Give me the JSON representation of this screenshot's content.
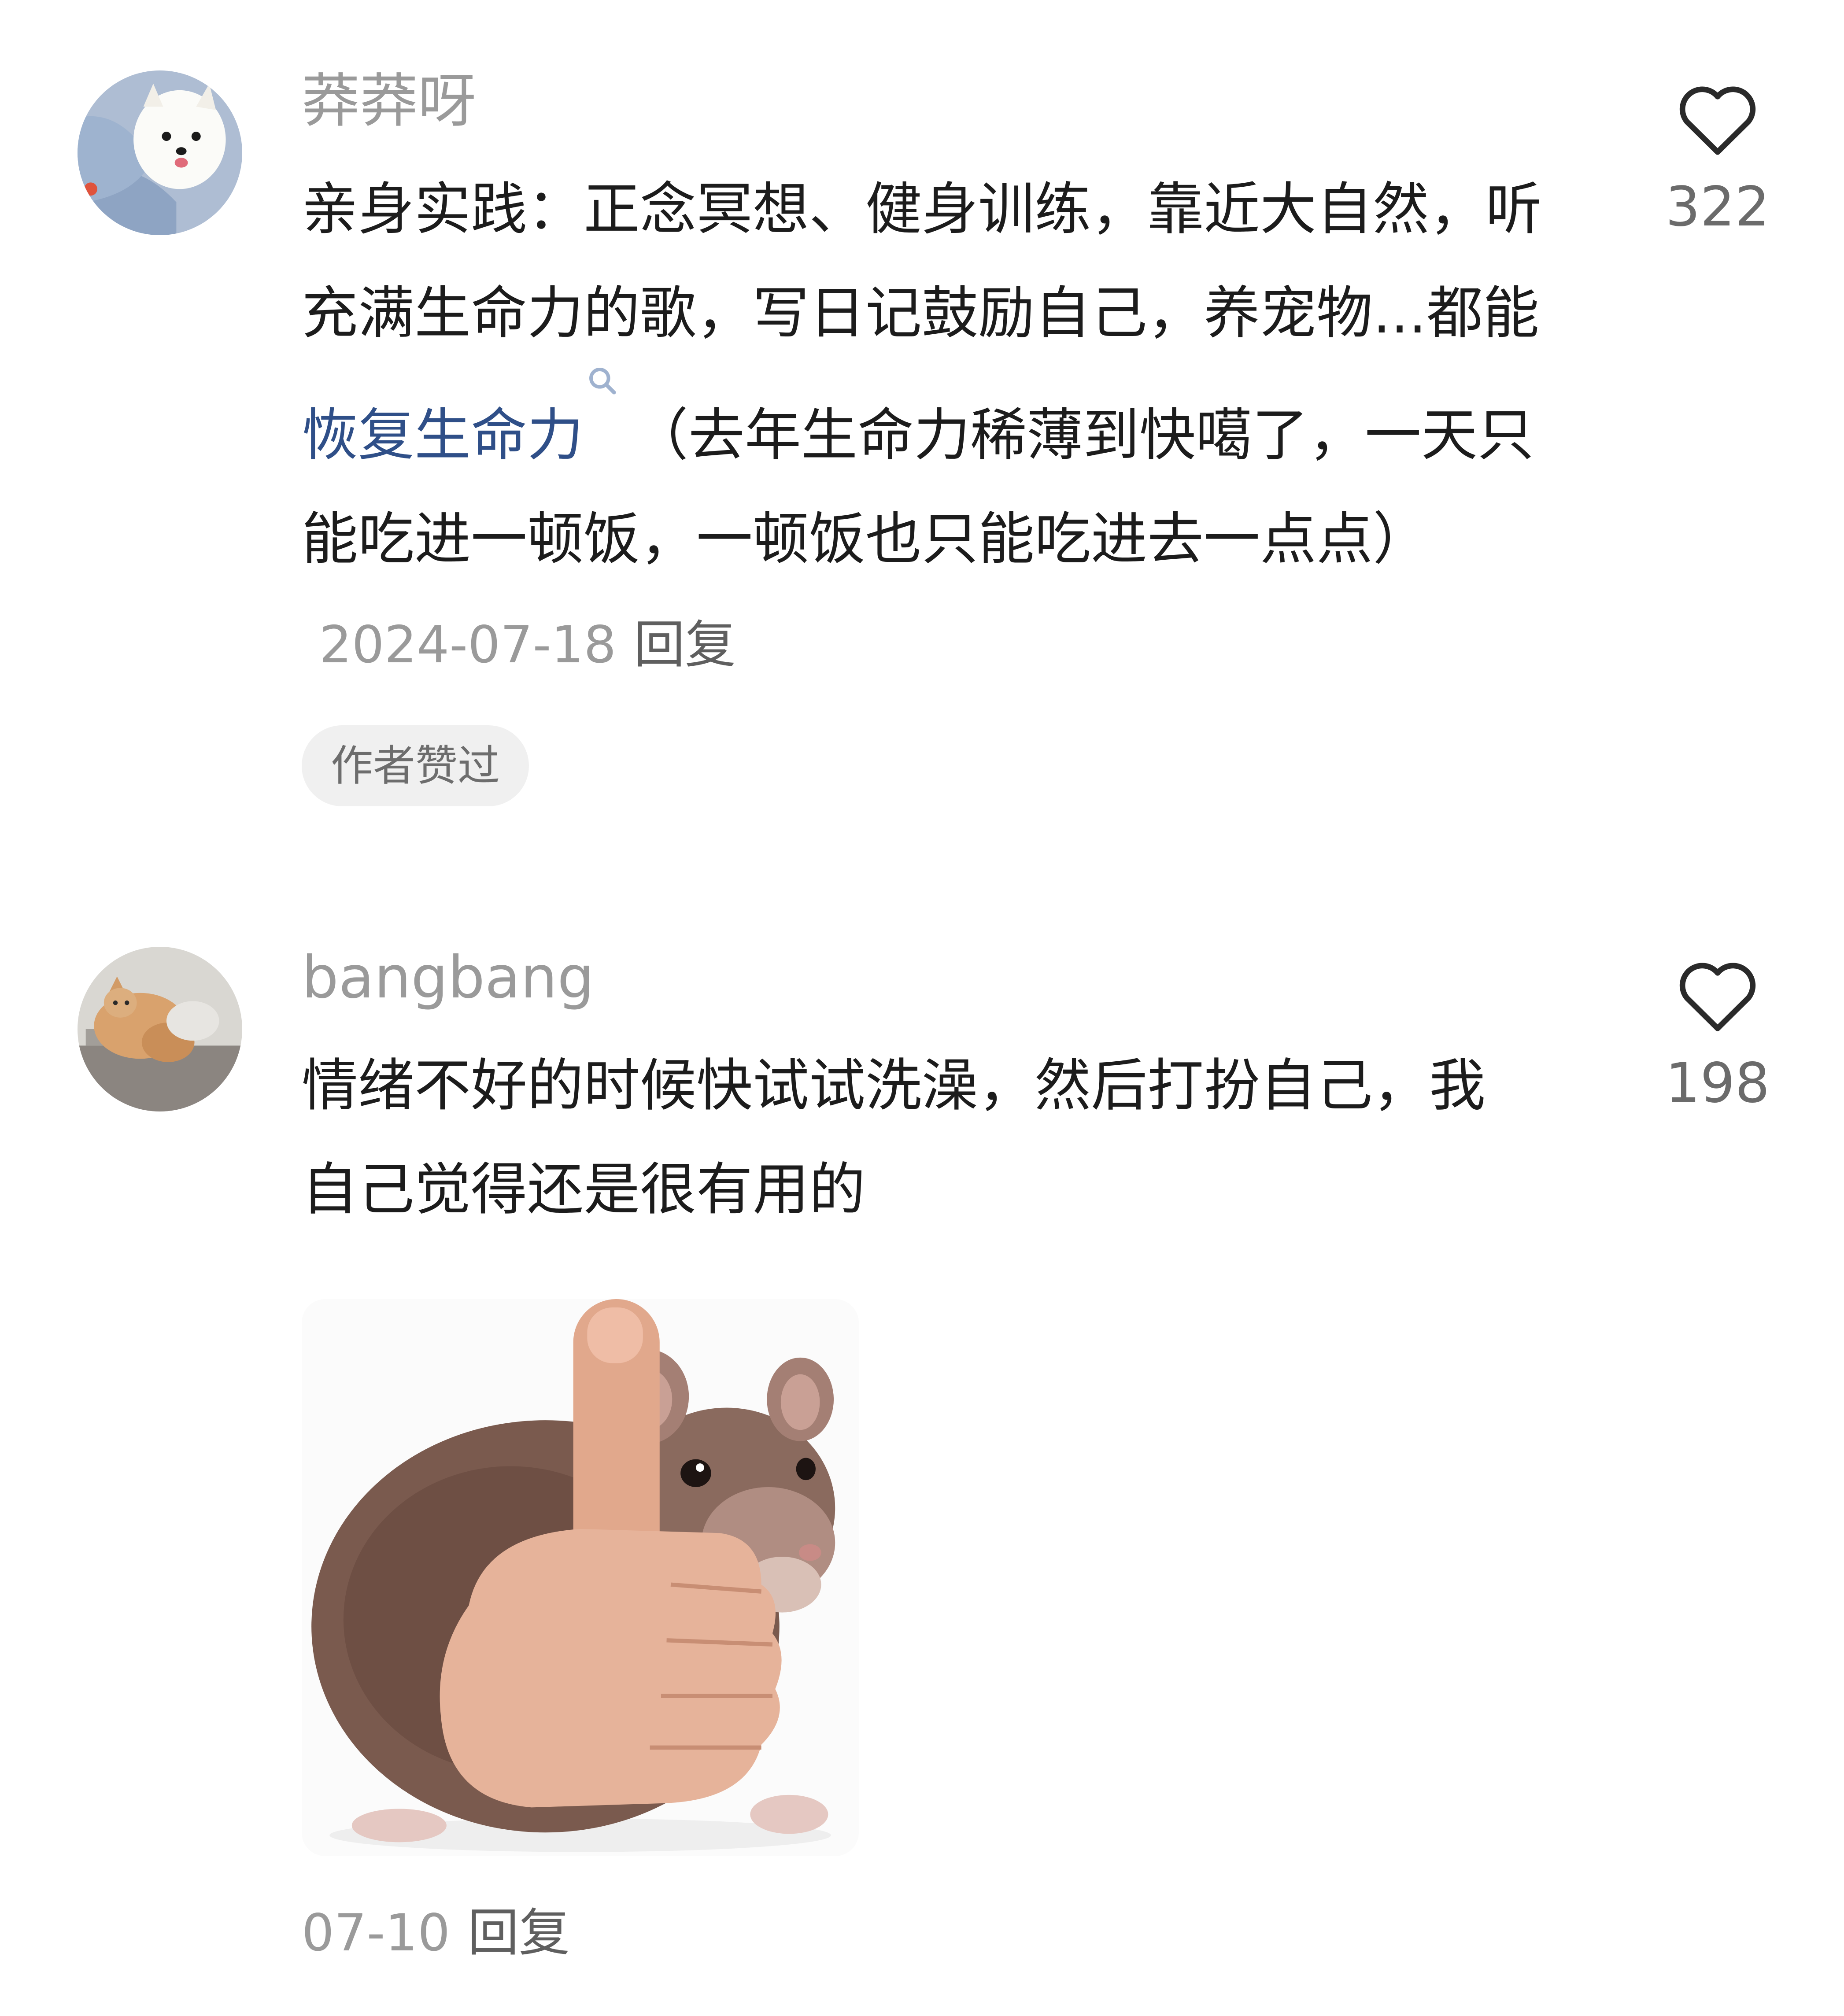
{
  "comments": [
    {
      "username": "莽莽呀",
      "text_before_link": "亲身实践：正念冥想、健身训练，靠近大自然，听充满生命力的歌，写日记鼓励自己，养宠物...都能 ",
      "link_text": "恢复生命力",
      "text_after_link": "（去年生命力稀薄到快噶了，一天只能吃进一顿饭，一顿饭也只能吃进去一点点）",
      "date": "2024-07-18",
      "reply_label": "回复",
      "badge": "作者赞过",
      "like_count": "322",
      "avatar_icon": "white-pomeranian-dog-avatar",
      "link_icon": "search-icon"
    },
    {
      "username": "bangbang",
      "text": "情绪不好的时候快试试洗澡，然后打扮自己，我自己觉得还是很有用的",
      "date": "07-10",
      "reply_label": "回复",
      "like_count": "198",
      "avatar_icon": "orange-cat-avatar",
      "sticker_icon": "rat-thumbs-up-sticker"
    }
  ],
  "colors": {
    "text": "#1c1c1c",
    "muted": "#9a9a9a",
    "link": "#2f4f88",
    "badge_bg": "#f0f0f0"
  }
}
